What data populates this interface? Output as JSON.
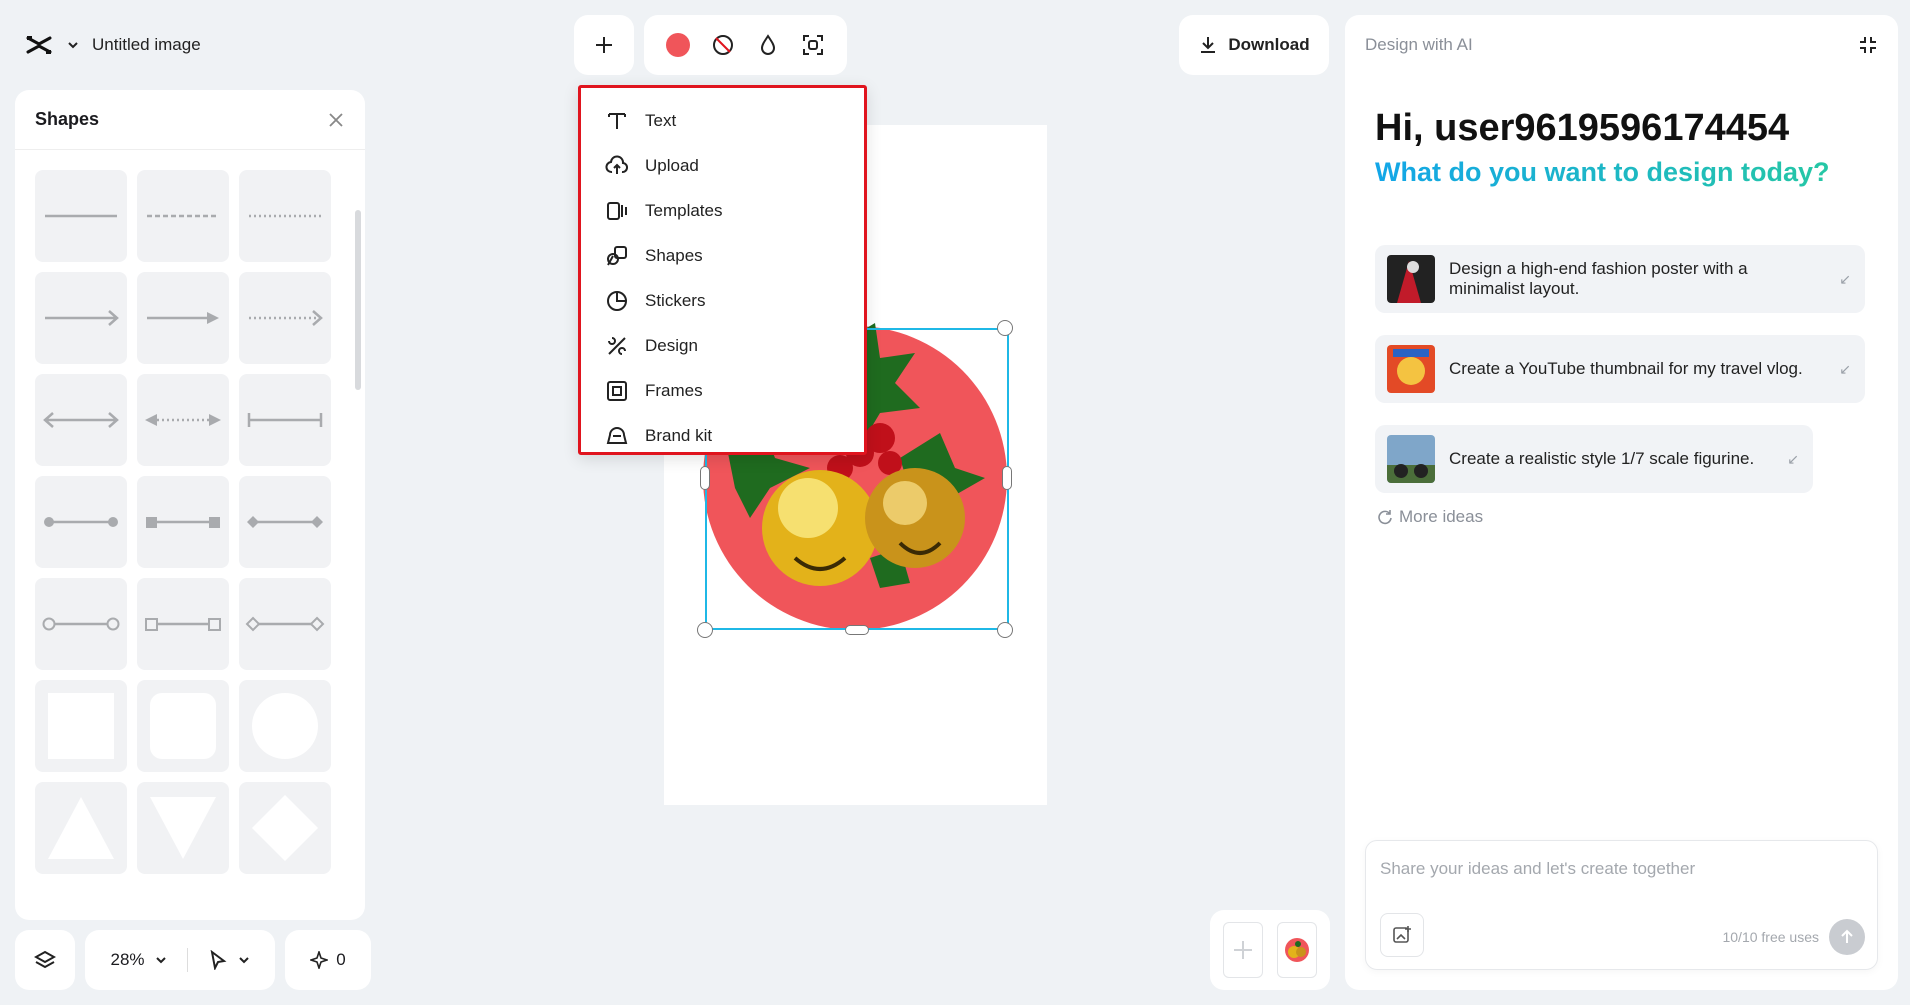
{
  "app": {
    "title": "Untitled image"
  },
  "toolbar": {
    "color_swatch": "#f0555a"
  },
  "download": {
    "label": "Download"
  },
  "shapes_panel": {
    "title": "Shapes"
  },
  "add_menu": {
    "items": [
      {
        "label": "Text",
        "icon": "text-icon"
      },
      {
        "label": "Upload",
        "icon": "upload-icon"
      },
      {
        "label": "Templates",
        "icon": "templates-icon"
      },
      {
        "label": "Shapes",
        "icon": "shapes-icon"
      },
      {
        "label": "Stickers",
        "icon": "stickers-icon"
      },
      {
        "label": "Design",
        "icon": "design-icon"
      },
      {
        "label": "Frames",
        "icon": "frames-icon"
      },
      {
        "label": "Brand kit",
        "icon": "brand-kit-icon"
      }
    ]
  },
  "bottom": {
    "zoom": "28%",
    "credits": "0"
  },
  "ai": {
    "header": "Design with AI",
    "greeting": "Hi, user9619596174454",
    "subtitle": "What do you want to design today?",
    "suggestions": [
      {
        "text": "Design a high-end fashion poster with a minimalist layout."
      },
      {
        "text": "Create a YouTube thumbnail for my travel vlog."
      },
      {
        "text": "Create a realistic style 1/7 scale figurine."
      }
    ],
    "more": "More ideas",
    "placeholder": "Share your ideas and let's create together",
    "uses": "10/10 free uses"
  },
  "colors": {
    "accent": "#13a6e8",
    "selection": "#1fb8e6",
    "highlight": "#e0141e"
  }
}
